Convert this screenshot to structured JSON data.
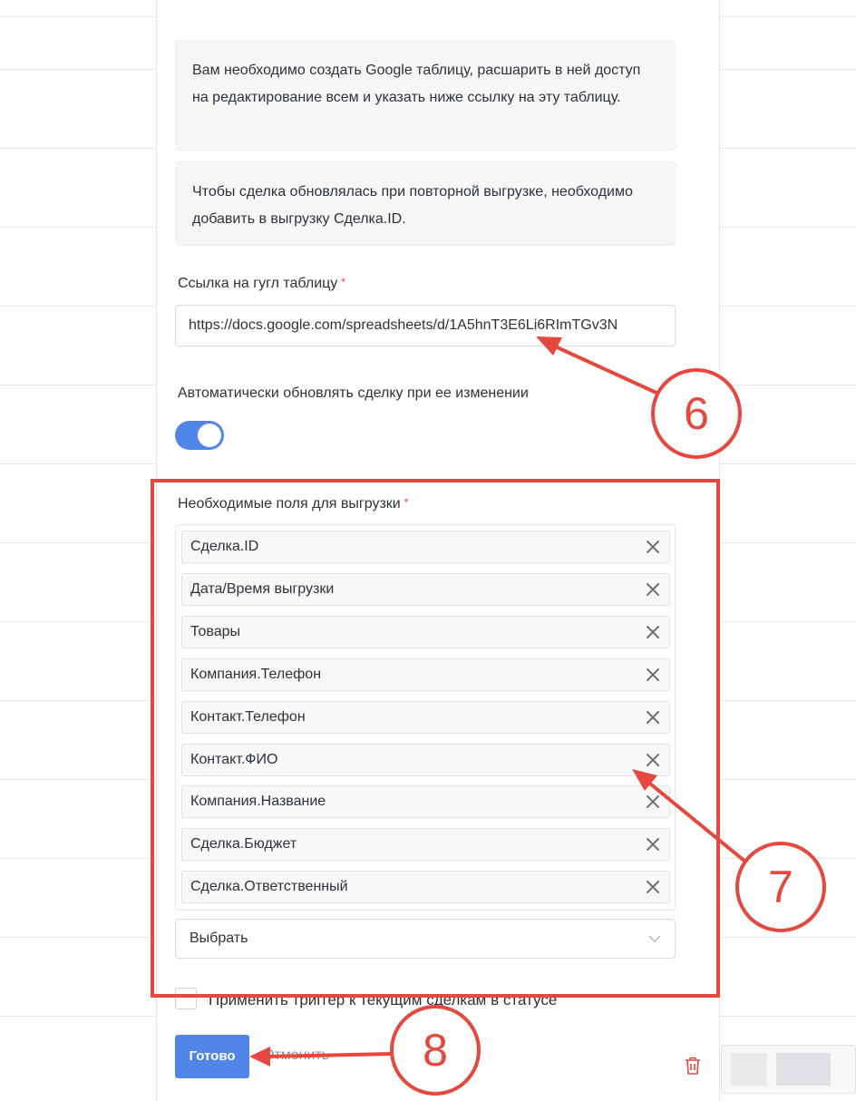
{
  "info": {
    "sheet_notice": "Вам необходимо создать Google таблицу, расшарить в ней доступ на редактирование всем и указать ниже ссылку на эту таблицу.",
    "update_notice": "Чтобы сделка обновлялась при повторной выгрузке, необходимо добавить в выгрузку Сделка.ID."
  },
  "url_field": {
    "label": "Ссылка на гугл таблицу",
    "required_mark": "*",
    "value": "https://docs.google.com/spreadsheets/d/1A5hnT3E6Li6RImTGv3N"
  },
  "auto_update": {
    "label": "Автоматически обновлять сделку при ее изменении",
    "enabled": true
  },
  "export_fields": {
    "label": "Необходимые поля для выгрузки",
    "required_mark": "*",
    "items": [
      "Сделка.ID",
      "Дата/Время выгрузки",
      "Товары",
      "Компания.Телефон",
      "Контакт.Телефон",
      "Контакт.ФИО",
      "Компания.Название",
      "Сделка.Бюджет",
      "Сделка.Ответственный"
    ],
    "select_placeholder": "Выбрать"
  },
  "apply_trigger": {
    "label": "Применить триггер к текущим сделкам в статусе",
    "checked": false
  },
  "actions": {
    "done_label": "Готово",
    "cancel_label": "Отменить"
  },
  "annotations": {
    "accent_color": "#e5483e",
    "markers": [
      "6",
      "7",
      "8"
    ]
  },
  "colors": {
    "primary": "#4f86e8",
    "danger": "#e5483e"
  }
}
